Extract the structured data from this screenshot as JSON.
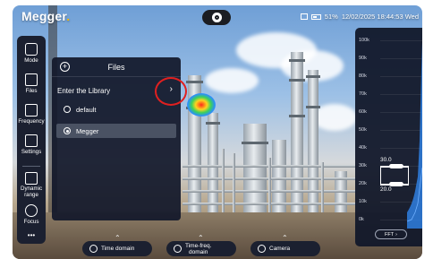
{
  "brand": {
    "name": "Megger",
    "dot": "."
  },
  "status": {
    "battery": "51%",
    "datetime": "12/02/2025 18:44:53 Wed"
  },
  "rail": [
    {
      "label": "Mode",
      "icon": "mode-grid-icon"
    },
    {
      "label": "Files",
      "icon": "files-image-icon"
    },
    {
      "label": "Frequency",
      "icon": "frequency-wave-icon"
    },
    {
      "label": "Settings",
      "icon": "settings-sliders-icon"
    },
    {
      "label": "Dynamic range",
      "icon": "dynamic-range-icon"
    },
    {
      "label": "Focus",
      "icon": "focus-target-icon"
    },
    {
      "label": "•••",
      "icon": "more-icon"
    }
  ],
  "files_panel": {
    "title": "Files",
    "library_label": "Enter the Library",
    "chevron": "›",
    "options": [
      {
        "label": "default",
        "selected": false
      },
      {
        "label": "Megger",
        "selected": true
      }
    ]
  },
  "spectrum": {
    "ticks": [
      "100k",
      "90k",
      "80k",
      "70k",
      "60k",
      "50k",
      "40k",
      "30k",
      "20k",
      "10k",
      "0k"
    ],
    "band_high": "30.0",
    "band_low": "20.0",
    "band_high_khz": 30,
    "band_low_khz": 20,
    "button": "FFT",
    "button_icon": "›"
  },
  "tabs": [
    {
      "label": "Time domain",
      "icon": "time-domain-icon"
    },
    {
      "label": "Time-freq.",
      "label2": "domain",
      "icon": "time-freq-icon"
    },
    {
      "label": "Camera",
      "icon": "camera-icon"
    }
  ],
  "colors": {
    "highlight_ring": "#e02020",
    "panel": "#12182a",
    "brand_dot": "#f2b705"
  }
}
